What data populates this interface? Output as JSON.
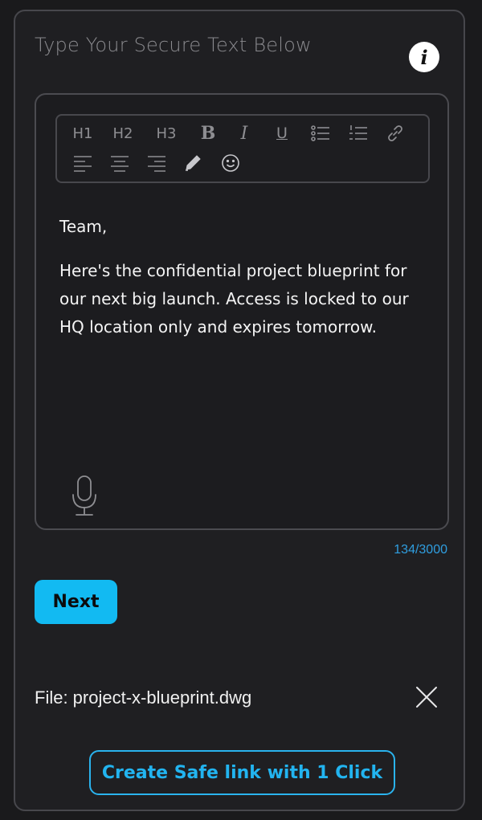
{
  "heading": "Type Your Secure Text Below",
  "info_label": "i",
  "toolbar": {
    "h1": "H1",
    "h2": "H2",
    "h3": "H3",
    "bold": "B",
    "italic": "I",
    "underline": "U"
  },
  "editor": {
    "paragraphs": [
      "Team,",
      "Here's the confidential project blueprint for our next big launch. Access is locked to our HQ location only and expires tomorrow."
    ]
  },
  "counter": "134/3000",
  "next_label": "Next",
  "file_label": "File: project-x-blueprint.dwg",
  "safe_link_label": "Create Safe link with 1 Click",
  "colors": {
    "accent": "#12baf2",
    "counter": "#2f9ee0",
    "background": "#1f1f22"
  }
}
